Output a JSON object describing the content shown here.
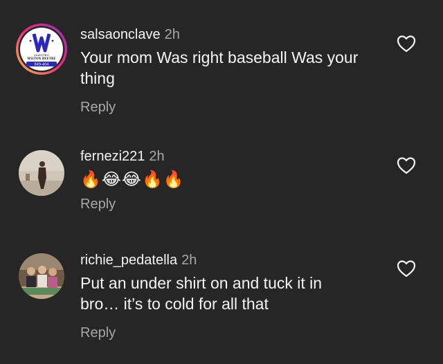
{
  "comments": [
    {
      "username": "salsaonclave",
      "time": "2h",
      "text": "Your mom Was right baseball Was your thing",
      "reply_label": "Reply",
      "avatar_logo_text": [
        "MAESTRO",
        "WILTON BEETRE",
        "849-404"
      ]
    },
    {
      "username": "fernezi221",
      "time": "2h",
      "text": "🔥😂😂🔥🔥",
      "reply_label": "Reply"
    },
    {
      "username": "richie_pedatella",
      "time": "2h",
      "text": "Put an under shirt on and tuck it in bro… it’s to cold for all that",
      "reply_label": "Reply"
    }
  ],
  "colors": {
    "background": "#262626",
    "primary_text": "#f5f5f5",
    "secondary_text": "#a8a8a8",
    "story_ring_start": "#f9c24a",
    "story_ring_end": "#d6249f"
  },
  "icons": {
    "like": "heart-outline-icon"
  }
}
